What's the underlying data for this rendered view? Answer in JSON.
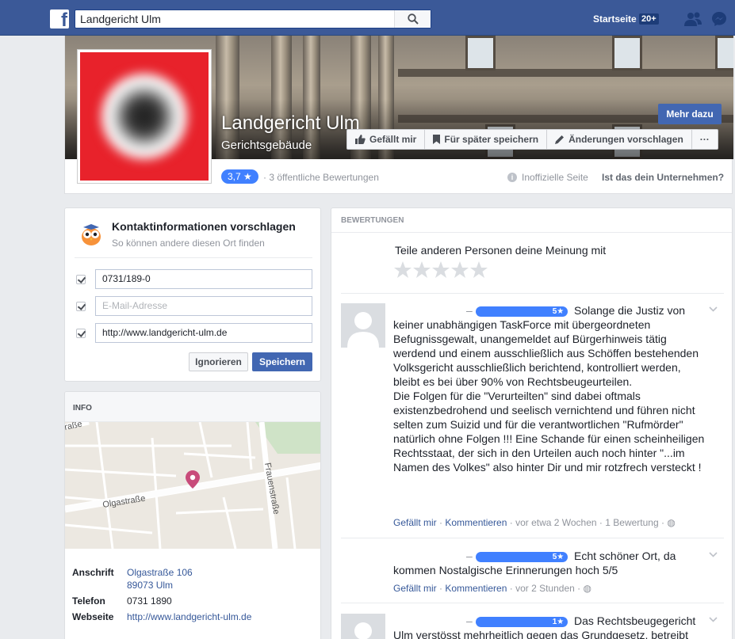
{
  "topbar": {
    "logo": "f",
    "search_value": "Landgericht Ulm",
    "home_label": "Startseite",
    "home_count": "20+",
    "icons": [
      "facebook-logo",
      "search-icon",
      "friends-icon",
      "messenger-icon"
    ]
  },
  "page": {
    "name": "Landgericht Ulm",
    "category": "Gerichtsgebäude",
    "more_button": "Mehr dazu",
    "actions": [
      "Gefällt mir",
      "Für später speichern",
      "Änderungen vorschlagen",
      "···"
    ],
    "rating": "3,7 ★",
    "rating_count": "· 3 öffentliche Bewertungen",
    "unofficial": "Inoffizielle Seite",
    "claim": "Ist das dein Unternehmen?",
    "accent": "#4267b2"
  },
  "contact": {
    "title": "Kontaktinformationen vorschlagen",
    "subtitle": "So können andere diesen Ort finden",
    "phone_value": "0731/189-0",
    "email_placeholder": "E-Mail-Adresse",
    "website_value": "http://www.landgericht-ulm.de",
    "ignore_button": "Ignorieren",
    "save_button": "Speichern"
  },
  "info": {
    "title": "INFO",
    "map_streets": [
      "Olgastraße",
      "Frauenstraße",
      "raße"
    ],
    "address_label": "Anschrift",
    "address_line1": "Olgastraße 106",
    "address_line2": "89073 Ulm",
    "phone_label": "Telefon",
    "phone_value": "0731 1890",
    "web_label": "Webseite",
    "web_value": "http://www.landgericht-ulm.de"
  },
  "reviews": {
    "header": "BEWERTUNGEN",
    "prompt": "Teile anderen Personen deine Meinung mit",
    "items": [
      {
        "badge": "5★",
        "text": "Solange die Justiz von keiner unabhängigen TaskForce mit übergeordneten Befugnissgewalt, unangemeldet auf Bürgerhinweis tätig werdend und einem ausschließlich aus Schöffen bestehenden Volksgericht ausschließlich berichtend, kontrolliert werden, bleibt es bei über 90% von Rechtsbeugeurteilen.",
        "text2": "Die Folgen für die \"Verurteilten\" sind dabei oftmals existenzbedrohend und seelisch vernichtend und führen nicht selten zum Suizid und für die verantwortlichen \"Rufmörder\" natürlich ohne Folgen !!! Eine Schande für einen scheinheiligen Rechtsstaat, der sich in den Urteilen auch noch hinter \"...im Namen des Volkes\" also hinter Dir und mir rotzfrech versteckt !",
        "like": "Gefällt mir",
        "comment": "Kommentieren",
        "time": "· vor etwa 2 Wochen ·",
        "extra": "1 Bewertung ·"
      },
      {
        "badge": "5★",
        "text": "Echt schöner Ort, da kommen Nostalgische Erinnerungen hoch 5/5",
        "like": "Gefällt mir",
        "comment": "Kommentieren",
        "time": "· vor 2 Stunden ·"
      },
      {
        "badge": "1★",
        "text": "Das Rechtsbeugegericht Ulm verstösst mehrheitlich gegen das Grundgesetz, betreibt ganz ungeniert"
      }
    ]
  }
}
